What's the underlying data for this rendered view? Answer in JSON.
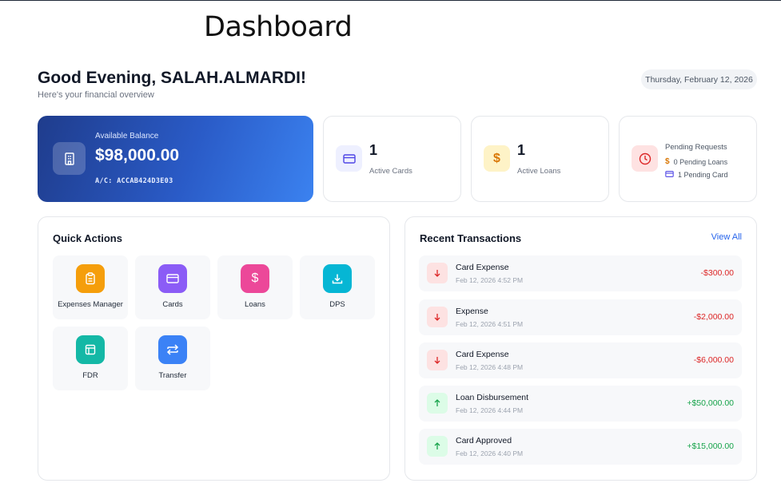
{
  "page": {
    "title": "Dashboard"
  },
  "header": {
    "greeting": "Good Evening, SALAH.ALMARDI!",
    "subtitle": "Here's your financial overview",
    "date": "Thursday, February 12, 2026"
  },
  "balance": {
    "label": "Available Balance",
    "amount": "$98,000.00",
    "account": "A/C: ACCAB424D3E03",
    "icon": "bank-icon"
  },
  "stats": {
    "cards": {
      "value": "1",
      "label": "Active Cards",
      "icon": "credit-card-icon",
      "color": "#4f46e5",
      "bg": "#eef0ff"
    },
    "loans": {
      "value": "1",
      "label": "Active Loans",
      "icon": "dollar-icon",
      "color": "#d97706",
      "bg": "#fef3c7"
    },
    "pending": {
      "title": "Pending Requests",
      "loans": "0 Pending Loans",
      "cards": "1 Pending Card",
      "icon": "clock-icon",
      "color": "#dc2626",
      "bg": "#fee2e2"
    }
  },
  "quick_actions": {
    "title": "Quick Actions",
    "items": [
      {
        "label": "Expenses Manager",
        "icon": "clipboard-icon",
        "color": "#f59e0b"
      },
      {
        "label": "Cards",
        "icon": "credit-card-icon",
        "color": "#8b5cf6"
      },
      {
        "label": "Loans",
        "icon": "dollar-icon",
        "color": "#ec4899"
      },
      {
        "label": "DPS",
        "icon": "download-icon",
        "color": "#06b6d4"
      },
      {
        "label": "FDR",
        "icon": "layout-icon",
        "color": "#14b8a6"
      },
      {
        "label": "Transfer",
        "icon": "transfer-icon",
        "color": "#3b82f6"
      }
    ]
  },
  "transactions": {
    "title": "Recent Transactions",
    "view_all": "View All",
    "items": [
      {
        "title": "Card Expense",
        "date": "Feb 12, 2026 4:52 PM",
        "amount": "-$300.00",
        "direction": "out"
      },
      {
        "title": "Expense",
        "date": "Feb 12, 2026 4:51 PM",
        "amount": "-$2,000.00",
        "direction": "out"
      },
      {
        "title": "Card Expense",
        "date": "Feb 12, 2026 4:48 PM",
        "amount": "-$6,000.00",
        "direction": "out"
      },
      {
        "title": "Loan Disbursement",
        "date": "Feb 12, 2026 4:44 PM",
        "amount": "+$50,000.00",
        "direction": "in"
      },
      {
        "title": "Card Approved",
        "date": "Feb 12, 2026 4:40 PM",
        "amount": "+$15,000.00",
        "direction": "in"
      }
    ]
  },
  "colors": {
    "negative": "#dc2626",
    "positive": "#16a34a",
    "negative_bg": "#fde2e2",
    "positive_bg": "#dcfce7"
  }
}
